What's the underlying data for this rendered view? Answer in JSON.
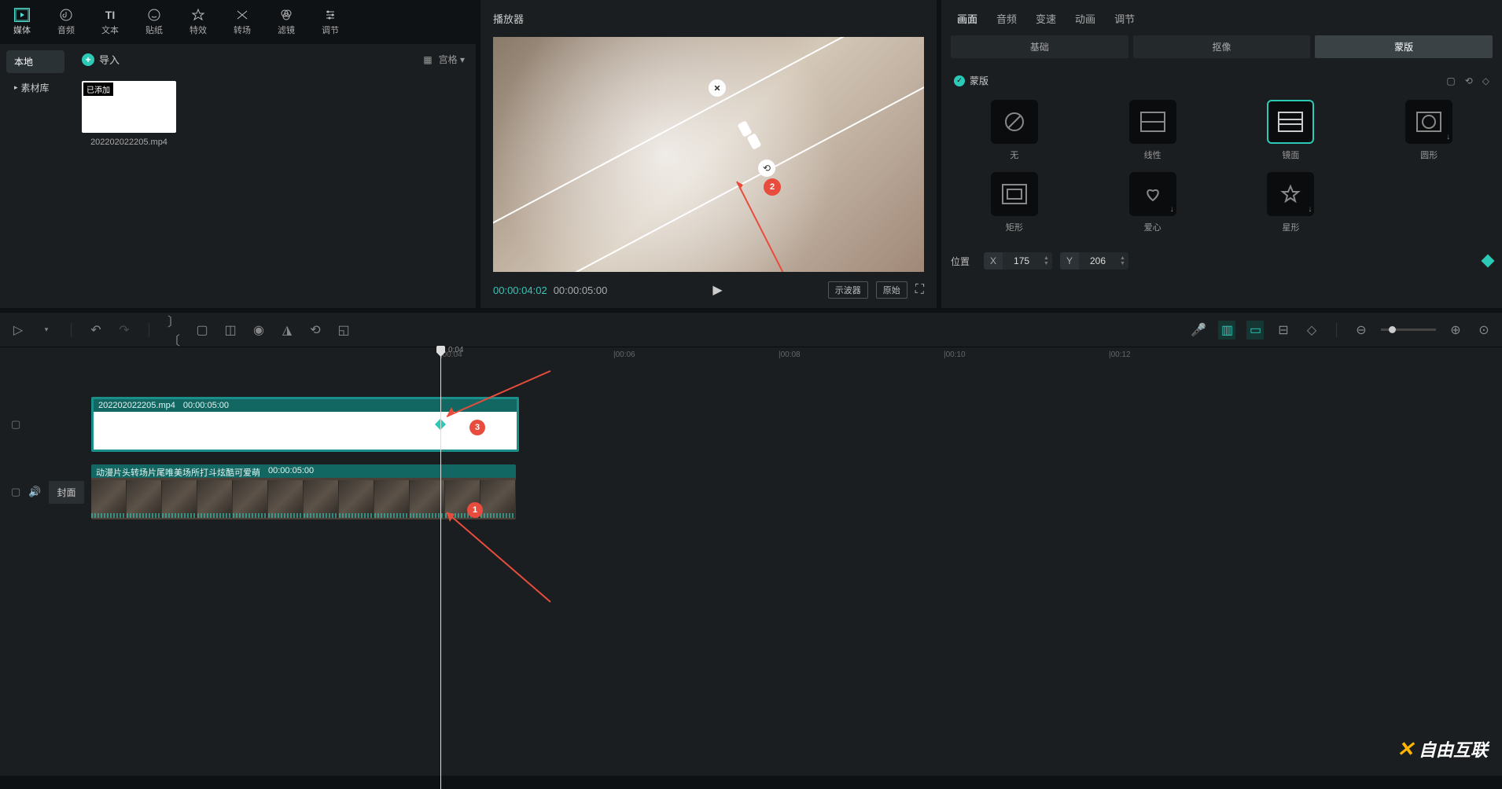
{
  "topTabs": [
    {
      "label": "媒体",
      "icon": "film"
    },
    {
      "label": "音频",
      "icon": "note"
    },
    {
      "label": "文本",
      "icon": "text"
    },
    {
      "label": "贴纸",
      "icon": "sticker"
    },
    {
      "label": "特效",
      "icon": "fx"
    },
    {
      "label": "转场",
      "icon": "transition"
    },
    {
      "label": "滤镜",
      "icon": "filter"
    },
    {
      "label": "调节",
      "icon": "adjust"
    }
  ],
  "leftSidebar": {
    "items": [
      {
        "label": "本地",
        "active": true
      },
      {
        "label": "素材库",
        "arrow": true
      }
    ]
  },
  "mediaHeader": {
    "import": "导入",
    "viewMode": "宫格"
  },
  "mediaItems": [
    {
      "name": "202202022205.mp4",
      "badge": "已添加"
    }
  ],
  "player": {
    "title": "播放器",
    "currentTime": "00:00:04:02",
    "totalTime": "00:00:05:00",
    "buttons": {
      "oscilloscope": "示波器",
      "original": "原始"
    }
  },
  "propTabs": [
    "画面",
    "音频",
    "变速",
    "动画",
    "调节"
  ],
  "subTabs": [
    "基础",
    "抠像",
    "蒙版"
  ],
  "mask": {
    "title": "蒙版",
    "items": [
      {
        "label": "无"
      },
      {
        "label": "线性"
      },
      {
        "label": "镜面",
        "selected": true
      },
      {
        "label": "圆形",
        "dl": true
      },
      {
        "label": "矩形"
      },
      {
        "label": "爱心",
        "dl": true
      },
      {
        "label": "星形",
        "dl": true
      }
    ]
  },
  "position": {
    "label": "位置",
    "x": "175",
    "y": "206"
  },
  "timeline": {
    "ticks": [
      "|00:04",
      "|00:06",
      "|00:08",
      "|00:10",
      "|00:12"
    ],
    "playheadLabel": "0:04",
    "clip1": {
      "name": "202202022205.mp4",
      "duration": "00:00:05:00"
    },
    "clip2": {
      "name": "动漫片头转场片尾唯美场所打斗炫酷可爱萌",
      "duration": "00:00:05:00"
    },
    "cover": "封面"
  },
  "annotations": {
    "b1": "1",
    "b2": "2",
    "b3": "3"
  },
  "watermark": {
    "brand": "自由互联"
  }
}
